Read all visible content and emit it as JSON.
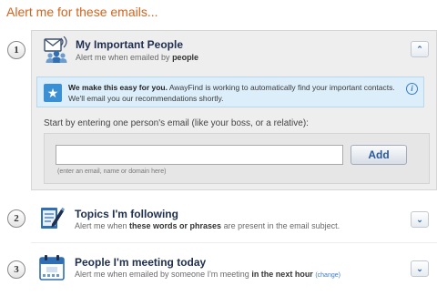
{
  "heading": "Alert me for these emails...",
  "steps": [
    {
      "number": "1",
      "title": "My Important People",
      "subtitle_prefix": "Alert me when emailed by ",
      "subtitle_bold": "people",
      "toggle": "expanded",
      "icon": "people-icon"
    },
    {
      "number": "2",
      "title": "Topics I'm following",
      "subtitle_prefix": "Alert me when ",
      "subtitle_bold": "these words or phrases",
      "subtitle_suffix": " are present in the email subject.",
      "toggle": "collapsed",
      "icon": "notepad-pencil-icon"
    },
    {
      "number": "3",
      "title": "People I'm meeting today",
      "subtitle_prefix": "Alert me when emailed by someone I'm meeting ",
      "subtitle_bold": "in the next hour",
      "link": "(change)",
      "toggle": "collapsed",
      "icon": "calendar-icon"
    }
  ],
  "info": {
    "bold": "We make this easy for you.",
    "text": " AwayFind is working to automatically find your important contacts. We'll email you our recommendations shortly."
  },
  "form": {
    "prompt": "Start by entering one person's email (like your boss, or a relative):",
    "input_value": "",
    "add_label": "Add",
    "hint": "(enter an email, name or domain here)"
  },
  "colors": {
    "heading": "#d2641e",
    "title": "#1e2f4f",
    "accent": "#3b7dc4",
    "info_bg": "#dceefa",
    "panel_bg": "#eeeeee"
  }
}
